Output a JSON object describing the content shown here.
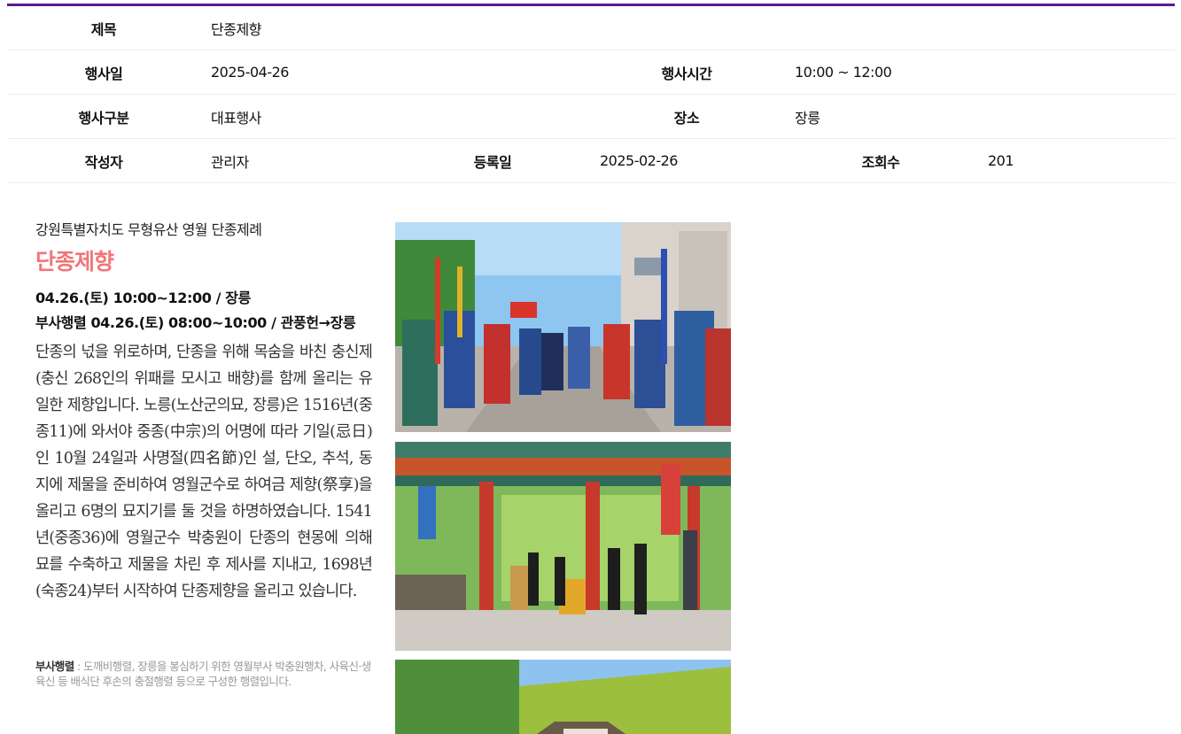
{
  "info": {
    "title_label": "제목",
    "title_value": "단종제향",
    "date_label": "행사일",
    "date_value": "2025-04-26",
    "time_label": "행사시간",
    "time_value": "10:00 ~ 12:00",
    "category_label": "행사구분",
    "category_value": "대표행사",
    "place_label": "장소",
    "place_value": "장릉",
    "author_label": "작성자",
    "author_value": "관리자",
    "registered_label": "등록일",
    "registered_value": "2025-02-26",
    "views_label": "조회수",
    "views_value": "201"
  },
  "article": {
    "subtitle": "강원특별자치도 무형유산 영월 단종제례",
    "heading": "단종제향",
    "schedule_1": "04.26.(토) 10:00~12:00 / 장릉",
    "schedule_2": "부사행렬 04.26.(토) 08:00~10:00  / 관풍헌→장릉",
    "body": "단종의 넋을 위로하며, 단종을 위해 목숨을 바친 충신제(충신 268인의 위패를 모시고 배향)를 함께 올리는 유일한 제향입니다. 노릉(노산군의묘, 장릉)은 1516년(중종11)에 와서야 중종(中宗)의 어명에 따라 기일(忌日)인 10월 24일과 사명절(四名節)인 설, 단오, 추석, 동지에 제물을 준비하여 영월군수로 하여금 제향(祭享)을 올리고 6명의 묘지기를 둘 것을 하명하였습니다. 1541년(중종36)에 영월군수 박충원이 단종의 현몽에 의해 묘를 수축하고 제물을 차린 후 제사를 지내고, 1698년(숙종24)부터 시작하여 단종제향을 올리고 있습니다.",
    "note_label": "부사행렬",
    "note_text": " : 도깨비행렬, 장릉을 봉심하기 위한 영월부사 박충원행차, 사육신·생육신 등 배식단 후손의 충절행렬 등으로 구성한 행렬입니다."
  },
  "colors": {
    "accent_bar": "#5a1a94",
    "heading": "#f0767a"
  }
}
